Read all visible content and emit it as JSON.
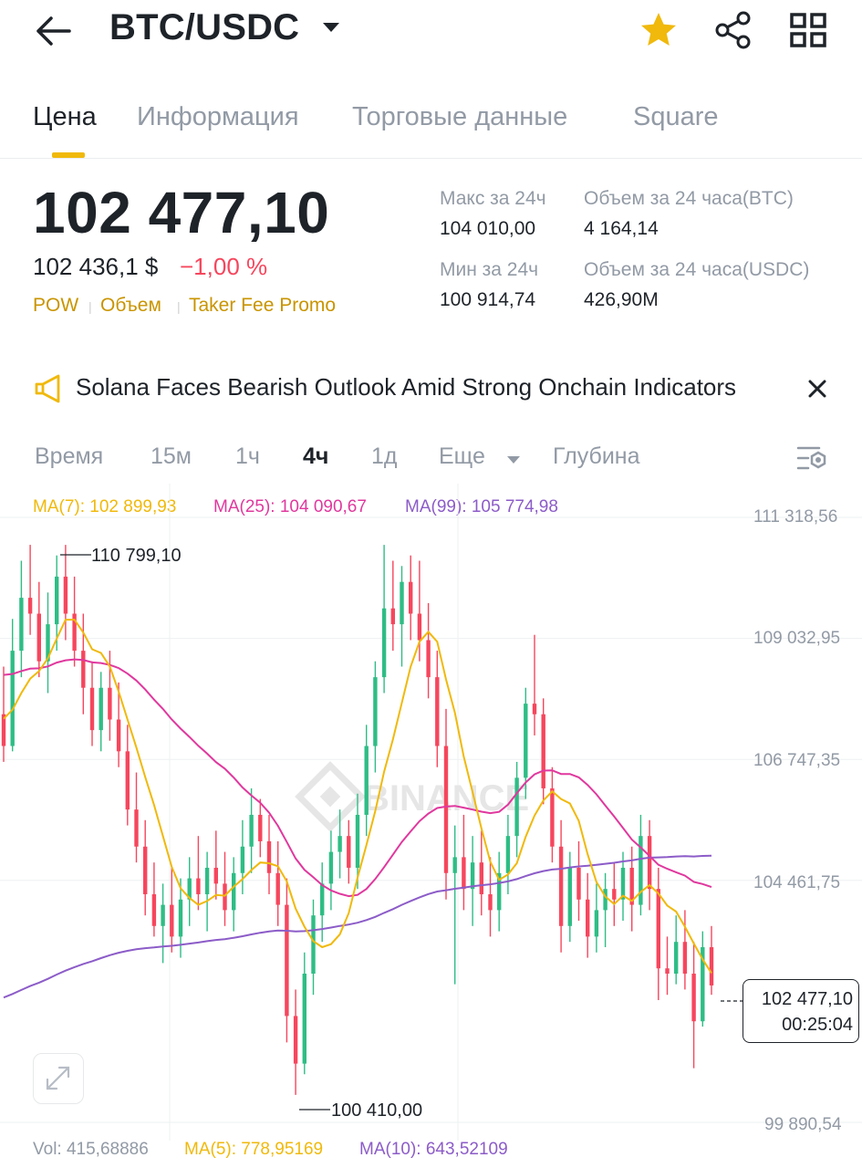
{
  "header": {
    "pair": "BTC/USDC",
    "icons": [
      "back-arrow-icon",
      "dropdown-caret-icon",
      "star-icon",
      "share-icon",
      "grid-icon"
    ]
  },
  "tabs": [
    {
      "label": "Цена",
      "active": true
    },
    {
      "label": "Информация",
      "active": false
    },
    {
      "label": "Торговые данные",
      "active": false
    },
    {
      "label": "Square",
      "active": false
    }
  ],
  "price": {
    "last": "102 477,10",
    "usd": "102 436,1 $",
    "change": "−1,00 %",
    "tags": [
      "POW",
      "Объем",
      "Taker Fee Promo"
    ]
  },
  "stats": {
    "high_label": "Макс за 24ч",
    "high_value": "104 010,00",
    "vol_btc_label": "Объем за 24 часа(BTC)",
    "vol_btc_value": "4 164,14",
    "low_label": "Мин за 24ч",
    "low_value": "100 914,74",
    "vol_usdc_label": "Объем за 24 часа(USDC)",
    "vol_usdc_value": "426,90M"
  },
  "news": {
    "text": "Solana Faces Bearish Outlook Amid Strong Onchain Indicators"
  },
  "intervals": {
    "items": [
      {
        "label": "Время",
        "active": false
      },
      {
        "label": "15м",
        "active": false
      },
      {
        "label": "1ч",
        "active": false
      },
      {
        "label": "4ч",
        "active": true
      },
      {
        "label": "1д",
        "active": false
      },
      {
        "label": "Еще",
        "active": false
      },
      {
        "label": "Глубина",
        "active": false
      }
    ]
  },
  "ma_legend": {
    "ma7": "MA(7): 102 899,93",
    "ma25": "MA(25): 104 090,67",
    "ma99": "MA(99): 105 774,98"
  },
  "chart": {
    "y_labels": [
      "111 318,56",
      "109 032,95",
      "106 747,35",
      "104 461,75",
      "99 890,54"
    ],
    "high_marker": "110 799,10",
    "low_marker": "100 410,00",
    "current_price": "102 477,10",
    "countdown": "00:25:04",
    "watermark": "BINANCE"
  },
  "volume": {
    "vol": "Vol: 415,68886",
    "ma5": "MA(5): 778,95169",
    "ma10": "MA(10): 643,52109"
  },
  "colors": {
    "accent": "#f0b90b",
    "up": "#2ebd85",
    "down": "#f6465d",
    "ma7": "#f0b90b",
    "ma25": "#e0389e",
    "ma99": "#8c5cc8",
    "text_primary": "#1e2329",
    "text_secondary": "#929aa5"
  },
  "chart_data": {
    "type": "candlestick",
    "interval": "4h",
    "ylim": [
      99890.54,
      111318.56
    ],
    "ticks": [
      111318.56,
      109032.95,
      106747.35,
      104461.75,
      99890.54
    ],
    "candles": [
      {
        "o": 107600,
        "h": 108500,
        "l": 106700,
        "c": 107000
      },
      {
        "o": 107000,
        "h": 109400,
        "l": 106900,
        "c": 108800
      },
      {
        "o": 108800,
        "h": 110500,
        "l": 108300,
        "c": 109800
      },
      {
        "o": 109800,
        "h": 110800,
        "l": 109100,
        "c": 109500
      },
      {
        "o": 109500,
        "h": 110100,
        "l": 108300,
        "c": 108600
      },
      {
        "o": 108600,
        "h": 109900,
        "l": 108000,
        "c": 109300
      },
      {
        "o": 109300,
        "h": 110600,
        "l": 108800,
        "c": 110200
      },
      {
        "o": 110200,
        "h": 110799,
        "l": 109000,
        "c": 109500
      },
      {
        "o": 109500,
        "h": 110200,
        "l": 108500,
        "c": 108800
      },
      {
        "o": 108800,
        "h": 109500,
        "l": 107600,
        "c": 108100
      },
      {
        "o": 108100,
        "h": 108600,
        "l": 107000,
        "c": 107300
      },
      {
        "o": 107300,
        "h": 108400,
        "l": 106900,
        "c": 108100
      },
      {
        "o": 108100,
        "h": 108800,
        "l": 107100,
        "c": 107500
      },
      {
        "o": 107500,
        "h": 108200,
        "l": 106600,
        "c": 106900
      },
      {
        "o": 106900,
        "h": 107400,
        "l": 105500,
        "c": 105800
      },
      {
        "o": 105800,
        "h": 106500,
        "l": 104800,
        "c": 105100
      },
      {
        "o": 105100,
        "h": 105600,
        "l": 103800,
        "c": 104200
      },
      {
        "o": 104200,
        "h": 104800,
        "l": 103400,
        "c": 103600
      },
      {
        "o": 103600,
        "h": 104400,
        "l": 102900,
        "c": 104000
      },
      {
        "o": 104000,
        "h": 104700,
        "l": 103100,
        "c": 103400
      },
      {
        "o": 103400,
        "h": 104500,
        "l": 103000,
        "c": 104100
      },
      {
        "o": 104100,
        "h": 104900,
        "l": 103600,
        "c": 104500
      },
      {
        "o": 104500,
        "h": 105300,
        "l": 103900,
        "c": 104200
      },
      {
        "o": 104200,
        "h": 105000,
        "l": 103500,
        "c": 104700
      },
      {
        "o": 104700,
        "h": 105400,
        "l": 104100,
        "c": 104400
      },
      {
        "o": 104400,
        "h": 105000,
        "l": 103600,
        "c": 103900
      },
      {
        "o": 103900,
        "h": 104900,
        "l": 103500,
        "c": 104600
      },
      {
        "o": 104600,
        "h": 105600,
        "l": 104200,
        "c": 105100
      },
      {
        "o": 105100,
        "h": 106200,
        "l": 104600,
        "c": 105700
      },
      {
        "o": 105700,
        "h": 106000,
        "l": 104900,
        "c": 105200
      },
      {
        "o": 105200,
        "h": 105700,
        "l": 104200,
        "c": 104600
      },
      {
        "o": 104600,
        "h": 105200,
        "l": 103600,
        "c": 104000
      },
      {
        "o": 104000,
        "h": 104500,
        "l": 101400,
        "c": 101900
      },
      {
        "o": 101900,
        "h": 102400,
        "l": 100410,
        "c": 101000
      },
      {
        "o": 101000,
        "h": 103100,
        "l": 100800,
        "c": 102700
      },
      {
        "o": 102700,
        "h": 104100,
        "l": 102300,
        "c": 103800
      },
      {
        "o": 103800,
        "h": 104800,
        "l": 103300,
        "c": 104400
      },
      {
        "o": 104400,
        "h": 105400,
        "l": 103900,
        "c": 105000
      },
      {
        "o": 105000,
        "h": 105800,
        "l": 104500,
        "c": 105300
      },
      {
        "o": 105300,
        "h": 105600,
        "l": 104400,
        "c": 104700
      },
      {
        "o": 104700,
        "h": 106100,
        "l": 104300,
        "c": 105700
      },
      {
        "o": 105700,
        "h": 107400,
        "l": 105300,
        "c": 107000
      },
      {
        "o": 107000,
        "h": 108600,
        "l": 106500,
        "c": 108300
      },
      {
        "o": 108300,
        "h": 110800,
        "l": 108000,
        "c": 109600
      },
      {
        "o": 109600,
        "h": 110500,
        "l": 108800,
        "c": 109300
      },
      {
        "o": 109300,
        "h": 110400,
        "l": 108500,
        "c": 110100
      },
      {
        "o": 110100,
        "h": 110600,
        "l": 109000,
        "c": 109500
      },
      {
        "o": 109500,
        "h": 110500,
        "l": 108600,
        "c": 109000
      },
      {
        "o": 109000,
        "h": 109700,
        "l": 107900,
        "c": 108300
      },
      {
        "o": 108300,
        "h": 108800,
        "l": 106600,
        "c": 107000
      },
      {
        "o": 107000,
        "h": 107700,
        "l": 104100,
        "c": 104600
      },
      {
        "o": 104600,
        "h": 105500,
        "l": 102500,
        "c": 104900
      },
      {
        "o": 104900,
        "h": 105700,
        "l": 103900,
        "c": 104300
      },
      {
        "o": 104300,
        "h": 105300,
        "l": 103600,
        "c": 104800
      },
      {
        "o": 104800,
        "h": 105400,
        "l": 103800,
        "c": 104200
      },
      {
        "o": 104200,
        "h": 104900,
        "l": 103400,
        "c": 103900
      },
      {
        "o": 103900,
        "h": 105000,
        "l": 103500,
        "c": 104600
      },
      {
        "o": 104600,
        "h": 105700,
        "l": 104200,
        "c": 105300
      },
      {
        "o": 105300,
        "h": 106700,
        "l": 104900,
        "c": 106400
      },
      {
        "o": 106400,
        "h": 108100,
        "l": 106000,
        "c": 107800
      },
      {
        "o": 107800,
        "h": 109100,
        "l": 107200,
        "c": 107600
      },
      {
        "o": 107600,
        "h": 107900,
        "l": 105900,
        "c": 106200
      },
      {
        "o": 106200,
        "h": 106600,
        "l": 104800,
        "c": 105100
      },
      {
        "o": 105100,
        "h": 105600,
        "l": 103100,
        "c": 103600
      },
      {
        "o": 103600,
        "h": 105000,
        "l": 103300,
        "c": 104700
      },
      {
        "o": 104700,
        "h": 105200,
        "l": 103700,
        "c": 104100
      },
      {
        "o": 104100,
        "h": 104600,
        "l": 103000,
        "c": 103400
      },
      {
        "o": 103400,
        "h": 104400,
        "l": 103100,
        "c": 103900
      },
      {
        "o": 103900,
        "h": 104600,
        "l": 103200,
        "c": 104300
      },
      {
        "o": 104300,
        "h": 104800,
        "l": 103600,
        "c": 104100
      },
      {
        "o": 104100,
        "h": 105000,
        "l": 103700,
        "c": 104700
      },
      {
        "o": 104700,
        "h": 105100,
        "l": 103500,
        "c": 104000
      },
      {
        "o": 104000,
        "h": 105700,
        "l": 103800,
        "c": 105300
      },
      {
        "o": 105300,
        "h": 105600,
        "l": 103900,
        "c": 104300
      },
      {
        "o": 104300,
        "h": 104700,
        "l": 102200,
        "c": 102800
      },
      {
        "o": 102800,
        "h": 103400,
        "l": 102300,
        "c": 102700
      },
      {
        "o": 102700,
        "h": 103800,
        "l": 102500,
        "c": 103300
      },
      {
        "o": 103300,
        "h": 103900,
        "l": 102400,
        "c": 102700
      },
      {
        "o": 102700,
        "h": 103300,
        "l": 100914,
        "c": 101800
      },
      {
        "o": 101800,
        "h": 103500,
        "l": 101700,
        "c": 103200
      },
      {
        "o": 103200,
        "h": 103600,
        "l": 102300,
        "c": 102477
      }
    ]
  }
}
